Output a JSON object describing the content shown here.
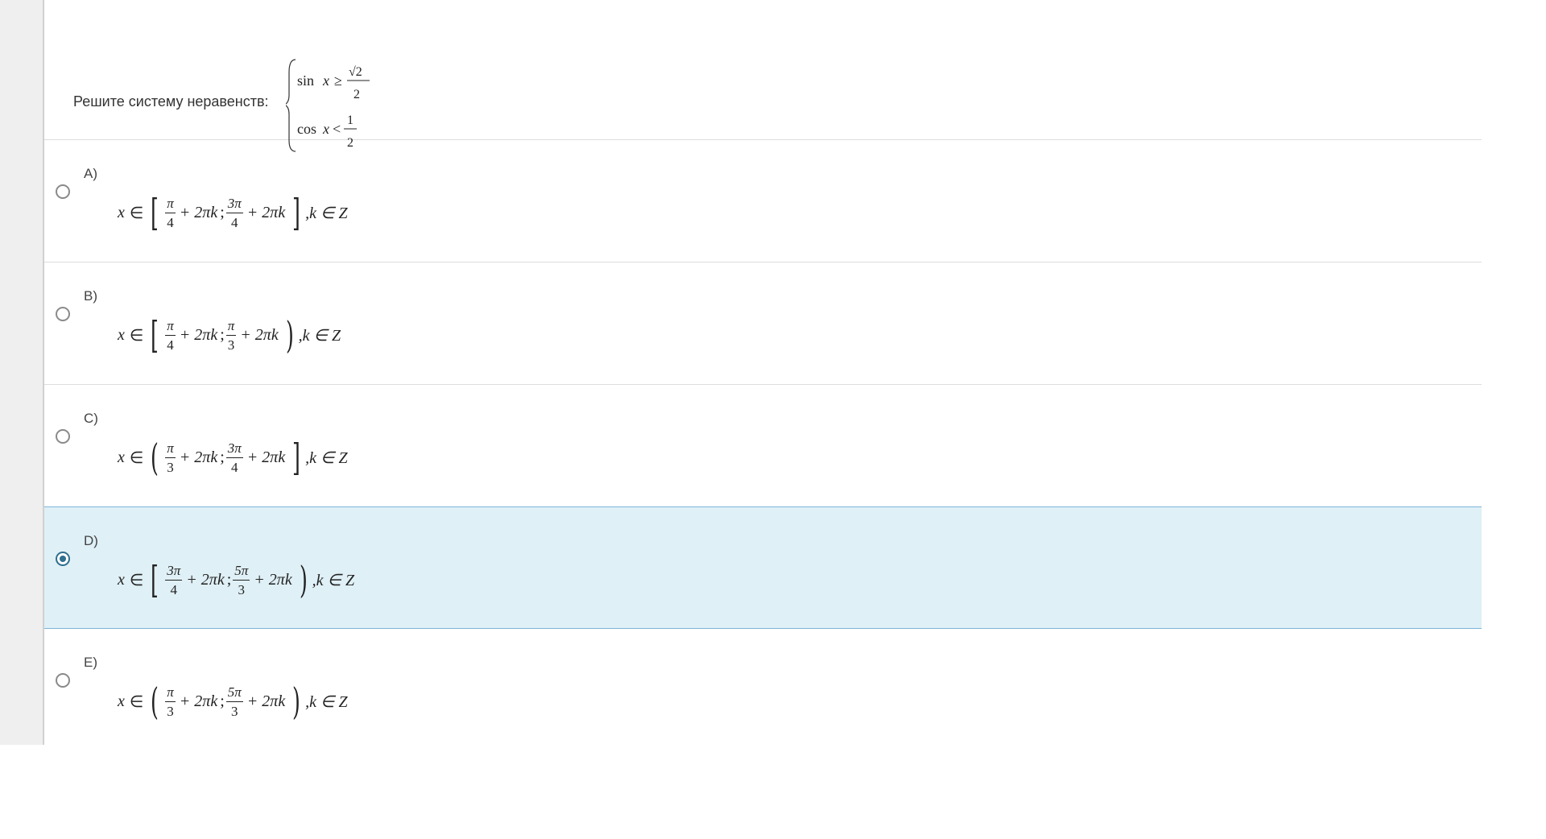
{
  "question": {
    "text": "Решите систему неравенств:",
    "system": {
      "line1_left": "sin",
      "line1_var": "x",
      "line1_op": "≥",
      "line1_num": "√2",
      "line1_den": "2",
      "line2_left": "cos",
      "line2_var": "x",
      "line2_op": "<",
      "line2_num": "1",
      "line2_den": "2"
    }
  },
  "options": [
    {
      "letter": "A)",
      "selected": false,
      "open": "[",
      "close": "]",
      "a_num": "π",
      "a_den": "4",
      "b_num": "3π",
      "b_den": "4"
    },
    {
      "letter": "B)",
      "selected": false,
      "open": "[",
      "close": ")",
      "a_num": "π",
      "a_den": "4",
      "b_num": "π",
      "b_den": "3"
    },
    {
      "letter": "C)",
      "selected": false,
      "open": "(",
      "close": "]",
      "a_num": "π",
      "a_den": "3",
      "b_num": "3π",
      "b_den": "4"
    },
    {
      "letter": "D)",
      "selected": true,
      "open": "[",
      "close": ")",
      "a_num": "3π",
      "a_den": "4",
      "b_num": "5π",
      "b_den": "3"
    },
    {
      "letter": "E)",
      "selected": false,
      "open": "(",
      "close": ")",
      "a_num": "π",
      "a_den": "3",
      "b_num": "5π",
      "b_den": "3"
    }
  ],
  "formula": {
    "x": "x",
    "in": "∈",
    "plus_term": "+ 2πk",
    "sep": ";",
    "tail": ",k ∈ Z"
  }
}
